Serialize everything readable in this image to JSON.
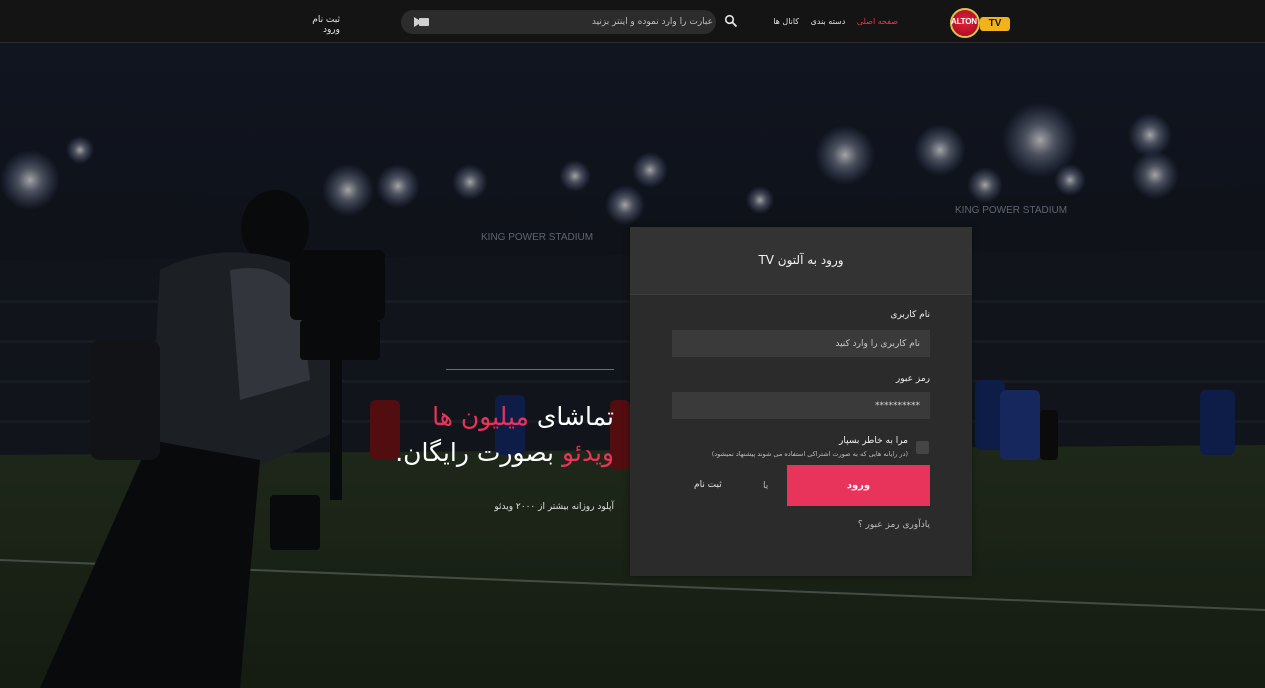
{
  "header": {
    "logo_text": "ALTON",
    "logo_badge": "TV",
    "nav": [
      {
        "label": "صفحه اصلی",
        "active": true
      },
      {
        "label": "دسته بندی",
        "active": false
      },
      {
        "label": "کانال ها",
        "active": false
      }
    ],
    "search_placeholder": "عبارت را وارد نموده و اینتر بزنید",
    "auth": {
      "login": "ورود",
      "register": "ثبت نام"
    }
  },
  "hero": {
    "title_part1": "تماشای ",
    "title_highlight1": "میلیون ها",
    "title_highlight2": "ویدئو",
    "title_part2": " بصورت رایگان.",
    "subtitle": "آپلود روزانه بیشتر از ۲۰۰۰ ویدئو"
  },
  "background": {
    "stadium_banner": "KING POWER STADIUM"
  },
  "login": {
    "title": "ورود به آلتون TV",
    "username_label": "نام کاربری",
    "username_placeholder": "نام کاربری را وارد کنید",
    "password_label": "رمز عبور",
    "password_value": "**********",
    "remember_label": "مرا به خاطر بسپار",
    "remember_note": "(در رایانه هایی که به صورت اشتراکی استفاده می شوند پیشنهاد نمیشود)",
    "submit": "ورود",
    "or": "یا",
    "signup": "ثبت نام",
    "forgot": "یادآوری رمز عبور ؟"
  },
  "colors": {
    "accent": "#e8335a",
    "header_bg": "#141414",
    "panel_bg": "#2b2b2b",
    "logo_badge": "#f2b21b"
  }
}
